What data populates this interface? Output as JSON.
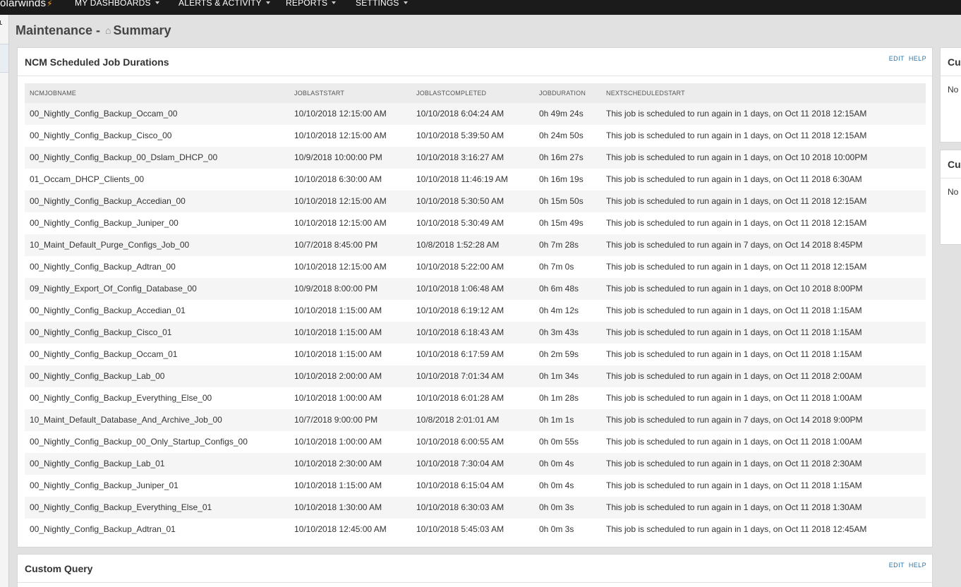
{
  "app": {
    "brand": "olarwinds",
    "bolt_glyph": "⚡"
  },
  "nav": [
    {
      "label": "MY DASHBOARDS"
    },
    {
      "label": "ALERTS & ACTIVITY"
    },
    {
      "label": "REPORTS"
    },
    {
      "label": "SETTINGS"
    }
  ],
  "page": {
    "title_prefix": "Maintenance -",
    "home_icon": "⌂",
    "title": "Summary"
  },
  "job_panel": {
    "title": "NCM Scheduled Job Durations",
    "edit": "EDIT",
    "help": "HELP",
    "columns": [
      "NCMJOBNAME",
      "JOBLASTSTART",
      "JOBLASTCOMPLETED",
      "JOBDURATION",
      "NEXTSCHEDULEDSTART"
    ],
    "rows": [
      [
        "00_Nightly_Config_Backup_Occam_00",
        "10/10/2018 12:15:00 AM",
        "10/10/2018 6:04:24 AM",
        "0h 49m 24s",
        "This job is scheduled to run again in 1 days, on Oct 11 2018 12:15AM"
      ],
      [
        "00_Nightly_Config_Backup_Cisco_00",
        "10/10/2018 12:15:00 AM",
        "10/10/2018 5:39:50 AM",
        "0h 24m 50s",
        "This job is scheduled to run again in 1 days, on Oct 11 2018 12:15AM"
      ],
      [
        "00_Nightly_Config_Backup_00_Dslam_DHCP_00",
        "10/9/2018 10:00:00 PM",
        "10/10/2018 3:16:27 AM",
        "0h 16m 27s",
        "This job is scheduled to run again in 1 days, on Oct 10 2018 10:00PM"
      ],
      [
        "01_Occam_DHCP_Clients_00",
        "10/10/2018 6:30:00 AM",
        "10/10/2018 11:46:19 AM",
        "0h 16m 19s",
        "This job is scheduled to run again in 1 days, on Oct 11 2018 6:30AM"
      ],
      [
        "00_Nightly_Config_Backup_Accedian_00",
        "10/10/2018 12:15:00 AM",
        "10/10/2018 5:30:50 AM",
        "0h 15m 50s",
        "This job is scheduled to run again in 1 days, on Oct 11 2018 12:15AM"
      ],
      [
        "00_Nightly_Config_Backup_Juniper_00",
        "10/10/2018 12:15:00 AM",
        "10/10/2018 5:30:49 AM",
        "0h 15m 49s",
        "This job is scheduled to run again in 1 days, on Oct 11 2018 12:15AM"
      ],
      [
        "10_Maint_Default_Purge_Configs_Job_00",
        "10/7/2018 8:45:00 PM",
        "10/8/2018 1:52:28 AM",
        "0h 7m 28s",
        "This job is scheduled to run again in 7 days, on Oct 14 2018 8:45PM"
      ],
      [
        "00_Nightly_Config_Backup_Adtran_00",
        "10/10/2018 12:15:00 AM",
        "10/10/2018 5:22:00 AM",
        "0h 7m 0s",
        "This job is scheduled to run again in 1 days, on Oct 11 2018 12:15AM"
      ],
      [
        "09_Nightly_Export_Of_Config_Database_00",
        "10/9/2018 8:00:00 PM",
        "10/10/2018 1:06:48 AM",
        "0h 6m 48s",
        "This job is scheduled to run again in 1 days, on Oct 10 2018 8:00PM"
      ],
      [
        "00_Nightly_Config_Backup_Accedian_01",
        "10/10/2018 1:15:00 AM",
        "10/10/2018 6:19:12 AM",
        "0h 4m 12s",
        "This job is scheduled to run again in 1 days, on Oct 11 2018 1:15AM"
      ],
      [
        "00_Nightly_Config_Backup_Cisco_01",
        "10/10/2018 1:15:00 AM",
        "10/10/2018 6:18:43 AM",
        "0h 3m 43s",
        "This job is scheduled to run again in 1 days, on Oct 11 2018 1:15AM"
      ],
      [
        "00_Nightly_Config_Backup_Occam_01",
        "10/10/2018 1:15:00 AM",
        "10/10/2018 6:17:59 AM",
        "0h 2m 59s",
        "This job is scheduled to run again in 1 days, on Oct 11 2018 1:15AM"
      ],
      [
        "00_Nightly_Config_Backup_Lab_00",
        "10/10/2018 2:00:00 AM",
        "10/10/2018 7:01:34 AM",
        "0h 1m 34s",
        "This job is scheduled to run again in 1 days, on Oct 11 2018 2:00AM"
      ],
      [
        "00_Nightly_Config_Backup_Everything_Else_00",
        "10/10/2018 1:00:00 AM",
        "10/10/2018 6:01:28 AM",
        "0h 1m 28s",
        "This job is scheduled to run again in 1 days, on Oct 11 2018 1:00AM"
      ],
      [
        "10_Maint_Default_Database_And_Archive_Job_00",
        "10/7/2018 9:00:00 PM",
        "10/8/2018 2:01:01 AM",
        "0h 1m 1s",
        "This job is scheduled to run again in 7 days, on Oct 14 2018 9:00PM"
      ],
      [
        "00_Nightly_Config_Backup_00_Only_Startup_Configs_00",
        "10/10/2018 1:00:00 AM",
        "10/10/2018 6:00:55 AM",
        "0h 0m 55s",
        "This job is scheduled to run again in 1 days, on Oct 11 2018 1:00AM"
      ],
      [
        "00_Nightly_Config_Backup_Lab_01",
        "10/10/2018 2:30:00 AM",
        "10/10/2018 7:30:04 AM",
        "0h 0m 4s",
        "This job is scheduled to run again in 1 days, on Oct 11 2018 2:30AM"
      ],
      [
        "00_Nightly_Config_Backup_Juniper_01",
        "10/10/2018 1:15:00 AM",
        "10/10/2018 6:15:04 AM",
        "0h 0m 4s",
        "This job is scheduled to run again in 1 days, on Oct 11 2018 1:15AM"
      ],
      [
        "00_Nightly_Config_Backup_Everything_Else_01",
        "10/10/2018 1:30:00 AM",
        "10/10/2018 6:30:03 AM",
        "0h 0m 3s",
        "This job is scheduled to run again in 1 days, on Oct 11 2018 1:30AM"
      ],
      [
        "00_Nightly_Config_Backup_Adtran_01",
        "10/10/2018 12:45:00 AM",
        "10/10/2018 5:45:03 AM",
        "0h 0m 3s",
        "This job is scheduled to run again in 1 days, on Oct 11 2018 12:45AM"
      ]
    ]
  },
  "custom_query_panel": {
    "title": "Custom Query",
    "edit": "EDIT",
    "help": "HELP"
  },
  "side_panels": [
    {
      "title": "Cu",
      "text": "No que"
    },
    {
      "title": "Cu",
      "text": "No que"
    }
  ]
}
